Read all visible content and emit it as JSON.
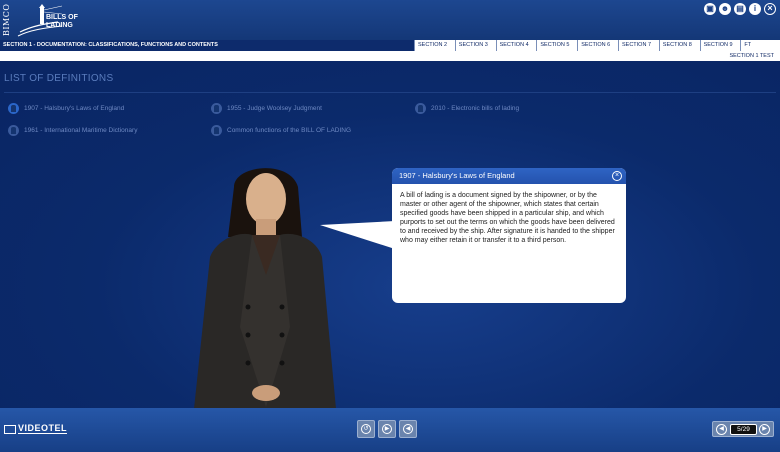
{
  "header": {
    "brand": "BIMCO",
    "logo_line1": "BILLS OF",
    "logo_line2": "LADING",
    "icons": [
      "book-icon",
      "people-icon",
      "document-icon",
      "info-icon",
      "close-icon"
    ]
  },
  "section_bar": {
    "title": "SECTION 1 - DOCUMENTATION: CLASSIFICATIONS, FUNCTIONS AND CONTENTS",
    "tabs": [
      "SECTION 2",
      "SECTION 3",
      "SECTION 4",
      "SECTION 5",
      "SECTION 6",
      "SECTION 7",
      "SECTION 8",
      "SECTION 9",
      "FT"
    ],
    "test_link": "SECTION 1 TEST"
  },
  "definitions": {
    "heading": "LIST OF DEFINITIONS",
    "items": [
      "1907 - Halsbury's Laws of England",
      "1955 - Judge Woolsey Judgment",
      "2010 - Electronic bills of lading",
      "1961 - International Maritime Dictionary",
      "Common functions of the BILL OF LADING"
    ]
  },
  "popup": {
    "title": "1907 - Halsbury's Laws of England",
    "body": "A bill of lading is a document signed by the shipowner, or by the master or other agent of the shipowner, which states that certain specified goods have been shipped in a particular ship, and which purports to set out the terms on which the goods have been delivered to and received by the ship. After signature it is handed to the shipper who may either retain it or transfer it to a third person."
  },
  "footer": {
    "brand": "VIDEOTEL",
    "page_counter": "5/29"
  },
  "colors": {
    "background": "#0a2a6e",
    "accent": "#2f64c4"
  }
}
